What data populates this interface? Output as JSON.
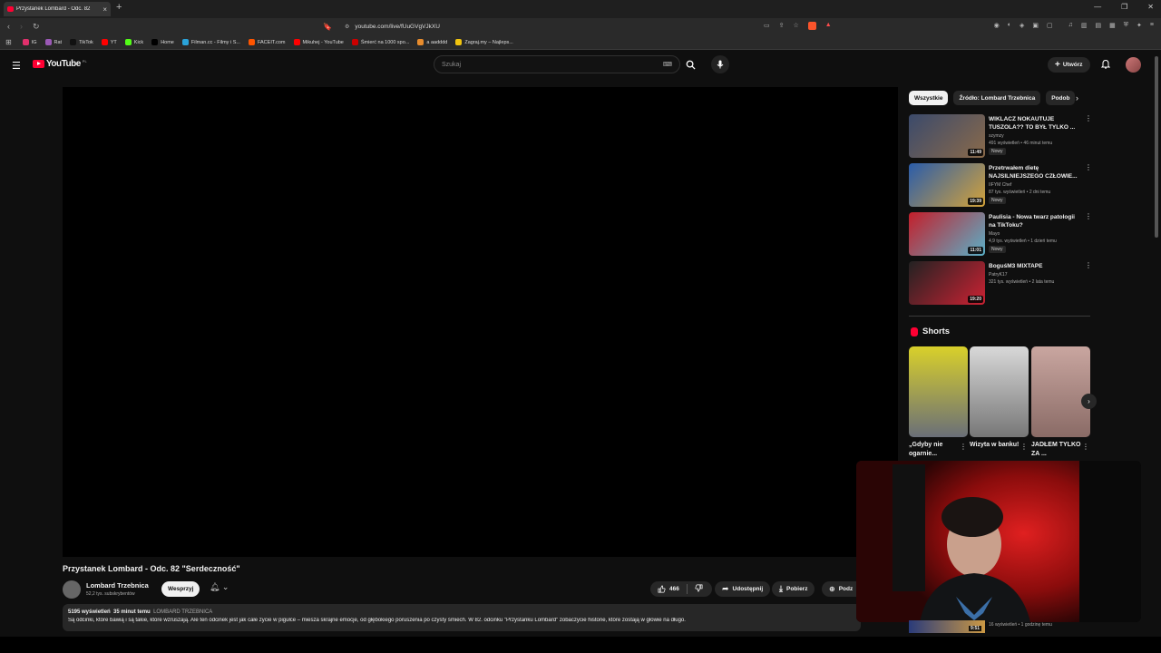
{
  "browser": {
    "tab_title": "Przystanek Lombard - Odc. 82",
    "url": "youtube.com/live/fUuGVgVJkXU",
    "bookmarks": [
      "IG",
      "Rat",
      "TikTok",
      "YT",
      "Kick",
      "Home",
      "Filman.cc - Filmy i S...",
      "FACEIT.com",
      "Mikuhej - YouTube",
      "Śmierć na 1000 spo...",
      "a aadddd",
      "Zagraj.my – Najleps..."
    ],
    "bookmark_colors": [
      "#e1306c",
      "#9b59b6",
      "#111111",
      "#ff0000",
      "#53fc18",
      "#000000",
      "#2aa3d9",
      "#ff5500",
      "#ff0000",
      "#cc0000",
      "#e88c2d",
      "#f1c40f"
    ]
  },
  "header": {
    "logo": "YouTube",
    "logo_country": "PL",
    "search_placeholder": "Szukaj",
    "create_label": "Utwórz"
  },
  "video": {
    "title": "Przystanek Lombard - Odc. 82 \"Serdeczność\"",
    "channel_name": "Lombard Trzebnica",
    "subscribers": "52,2 tys. subskrybentów",
    "support_label": "Wesprzyj",
    "likes": "466",
    "share_label": "Udostępnij",
    "download_label": "Pobierz",
    "clip_label": "Podz",
    "views": "5195 wyświetleń",
    "time_ago": "35 minut temu",
    "tag": "LOMBARD TRZEBNICA",
    "description": "Są odcinki, które bawią i są takie, które wzruszają. Ale ten odcinek jest jak całe życie w pigułce – miesza skrajne emocje, od głębokiego poruszenia po czysty śmiech. W 82. odcinku \"Przystanku Lombard\" zobaczycie historie, które zostają w głowie na długo."
  },
  "sidebar": {
    "chips": [
      "Wszystkie",
      "Źródło: Lombard Trzebnica",
      "Podob"
    ],
    "recommendations": [
      {
        "title": "WIKLACZ NOKAUTUJE TUSZOLA?? TO BYŁ TYLKO ...",
        "channel": "szymzy",
        "meta": "491 wyświetleń • 46 minut temu",
        "badge": "Nowy",
        "duration": "11:49",
        "colors": [
          "#3b4a6b",
          "#8a6a4a"
        ]
      },
      {
        "title": "Przetrwałem dietę NAJSILNIEJSZEGO CZŁOWIE...",
        "channel": "IIFYM Chef",
        "meta": "87 tys. wyświetleń • 2 dni temu",
        "badge": "Nowy",
        "duration": "19:39",
        "colors": [
          "#2a5caa",
          "#d4a33a"
        ]
      },
      {
        "title": "Paulisia - Nowa twarz patologii na TikToku?",
        "channel": "Mayo",
        "meta": "4,9 tys. wyświetleń • 1 dzień temu",
        "badge": "Nowy",
        "duration": "11:01",
        "colors": [
          "#c41e2a",
          "#5ab0c8"
        ]
      },
      {
        "title": "BoguśM3 MIXTAPE",
        "channel": "PatryK17",
        "meta": "321 tys. wyświetleń • 2 lata temu",
        "badge": "",
        "duration": "19:20",
        "colors": [
          "#222222",
          "#cc2233"
        ]
      }
    ],
    "shorts_heading": "Shorts",
    "shorts": [
      {
        "title": "„Gdyby nie ogarnie...",
        "colors": [
          "#d9d02a",
          "#6a6f78"
        ]
      },
      {
        "title": "Wizyta w banku!",
        "colors": [
          "#d8d8d8",
          "#777777"
        ]
      },
      {
        "title": "JADŁEM TYLKO ZA ...",
        "colors": [
          "#c9a6a0",
          "#8a6b66"
        ]
      }
    ],
    "last_meta": "16 wyświetleń • 1 godzinę temu",
    "last_duration": "9:51"
  }
}
